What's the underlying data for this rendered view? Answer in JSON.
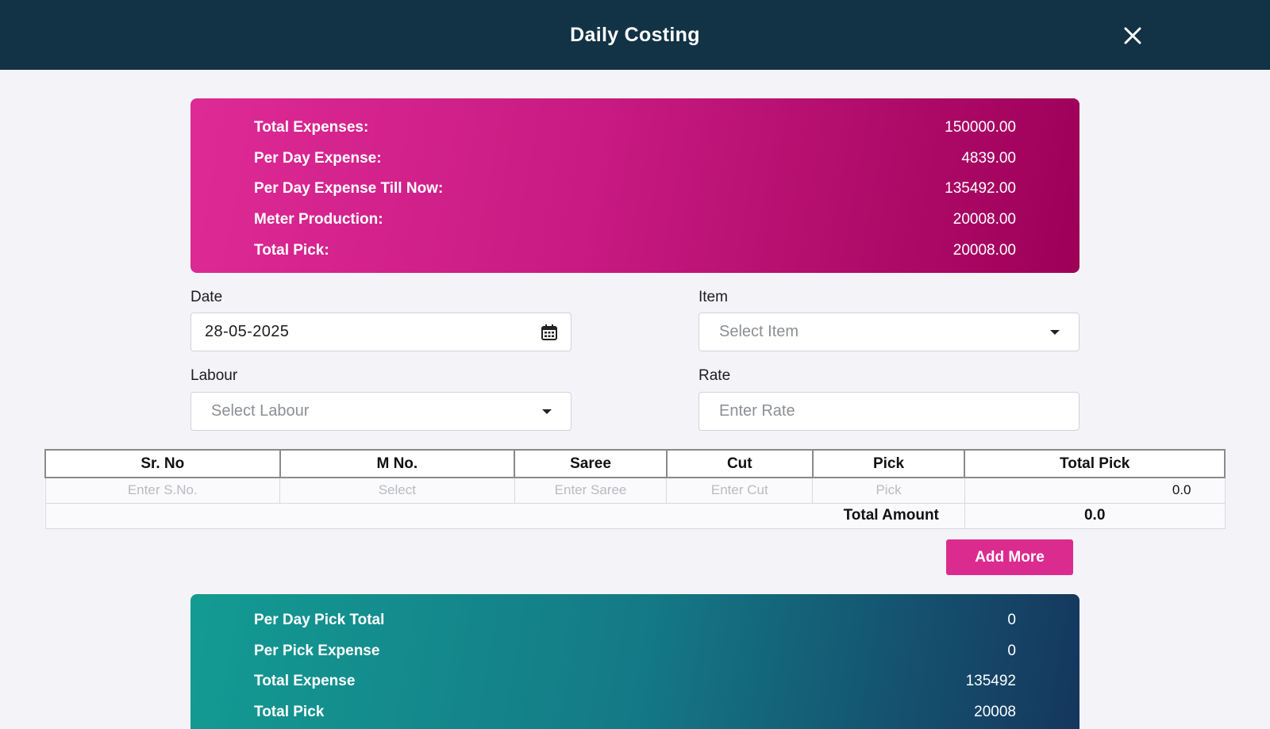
{
  "header": {
    "title": "Daily Costing",
    "close_icon": "close-icon"
  },
  "summary": [
    {
      "label": "Total Expenses:",
      "value": "150000.00"
    },
    {
      "label": "Per Day Expense:",
      "value": "4839.00"
    },
    {
      "label": "Per Day Expense Till Now:",
      "value": "135492.00"
    },
    {
      "label": "Meter Production:",
      "value": "20008.00"
    },
    {
      "label": "Total Pick:",
      "value": "20008.00"
    }
  ],
  "form": {
    "date": {
      "label": "Date",
      "value": "28-05-2025"
    },
    "item": {
      "label": "Item",
      "placeholder": "Select Item"
    },
    "labour": {
      "label": "Labour",
      "placeholder": "Select Labour"
    },
    "rate": {
      "label": "Rate",
      "placeholder": "Enter Rate"
    }
  },
  "table": {
    "headers": [
      "Sr. No",
      "M No.",
      "Saree",
      "Cut",
      "Pick",
      "Total Pick"
    ],
    "row": {
      "sr_placeholder": "Enter S.No.",
      "m_placeholder": "Select",
      "saree_placeholder": "Enter Saree",
      "cut_placeholder": "Enter Cut",
      "pick_placeholder": "Pick",
      "total_pick": "0.0"
    },
    "total_label": "Total Amount",
    "total_value": "0.0"
  },
  "add_more_label": "Add More",
  "totals": [
    {
      "label": "Per Day Pick Total",
      "value": "0"
    },
    {
      "label": "Per Pick Expense",
      "value": "0"
    },
    {
      "label": "Total Expense",
      "value": "135492"
    },
    {
      "label": "Total Pick",
      "value": "20008"
    }
  ],
  "colors": {
    "header_bg": "#123345",
    "accent_pink": "#dc2b8f",
    "summary_gradient": [
      "#de2a95",
      "#9d0058"
    ],
    "totals_gradient": [
      "#139b93",
      "#15365e"
    ]
  }
}
